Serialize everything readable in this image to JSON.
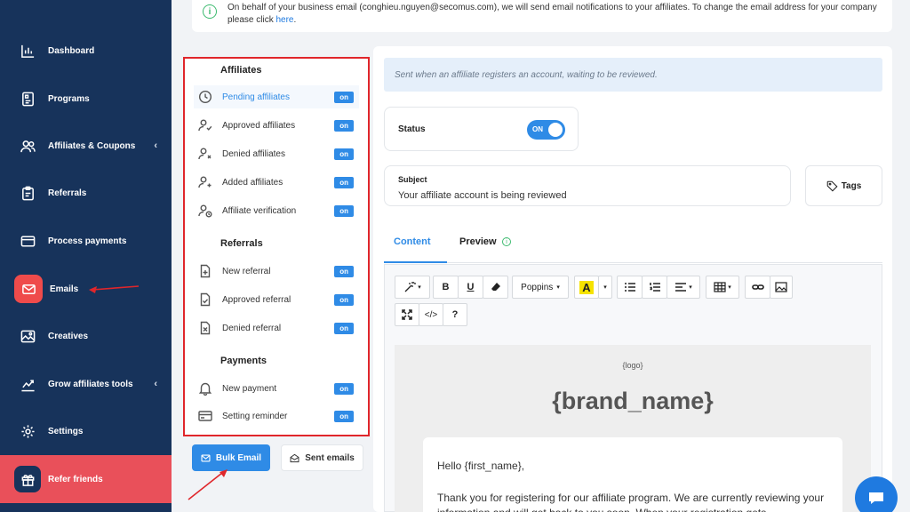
{
  "sidebar": {
    "items": [
      {
        "label": "Dashboard",
        "icon": "bar-chart-icon"
      },
      {
        "label": "Programs",
        "icon": "document-icon"
      },
      {
        "label": "Affiliates & Coupons",
        "icon": "users-icon",
        "has_chevron": true
      },
      {
        "label": "Referrals",
        "icon": "clipboard-icon"
      },
      {
        "label": "Process payments",
        "icon": "card-icon"
      },
      {
        "label": "Emails",
        "icon": "mail-icon",
        "active": true
      },
      {
        "label": "Creatives",
        "icon": "image-icon"
      },
      {
        "label": "Grow affiliates tools",
        "icon": "growth-icon",
        "has_chevron": true
      },
      {
        "label": "Settings",
        "icon": "gear-icon"
      }
    ],
    "refer": {
      "label": "Refer friends",
      "icon": "gift-icon"
    },
    "chevron": "‹"
  },
  "notice": {
    "text": "On behalf of your business email (conghieu.nguyen@secomus.com), we will send email notifications to your affiliates. To change the email address for your company please click ",
    "link": "here",
    "suffix": "."
  },
  "email_list": {
    "sections": [
      {
        "title": "Affiliates",
        "items": [
          {
            "label": "Pending affiliates",
            "icon": "clock-icon",
            "toggle": "on",
            "selected": true
          },
          {
            "label": "Approved affiliates",
            "icon": "user-check-icon",
            "toggle": "on"
          },
          {
            "label": "Denied affiliates",
            "icon": "user-x-icon",
            "toggle": "on"
          },
          {
            "label": "Added affiliates",
            "icon": "user-plus-icon",
            "toggle": "on"
          },
          {
            "label": "Affiliate verification",
            "icon": "user-clock-icon",
            "toggle": "on"
          }
        ]
      },
      {
        "title": "Referrals",
        "items": [
          {
            "label": "New referral",
            "icon": "file-plus-icon",
            "toggle": "on"
          },
          {
            "label": "Approved referral",
            "icon": "file-check-icon",
            "toggle": "on"
          },
          {
            "label": "Denied referral",
            "icon": "file-x-icon",
            "toggle": "on"
          }
        ]
      },
      {
        "title": "Payments",
        "items": [
          {
            "label": "New payment",
            "icon": "bell-icon",
            "toggle": "on"
          },
          {
            "label": "Setting reminder",
            "icon": "card-icon",
            "toggle": "on"
          }
        ]
      }
    ],
    "bulk_email": "Bulk Email",
    "sent_emails": "Sent emails"
  },
  "editor_panel": {
    "description": "Sent when an affiliate registers an account, waiting to be reviewed.",
    "status_label": "Status",
    "status_toggle": "ON",
    "subject_label": "Subject",
    "subject_value": "Your affiliate account is being reviewed",
    "tags_button": "Tags",
    "tabs": {
      "content": "Content",
      "preview": "Preview"
    },
    "toolbar": {
      "bold": "B",
      "underline": "U",
      "font": "Poppins",
      "code": "</>",
      "help": "?",
      "highlight": "A"
    },
    "email_preview": {
      "logo_placeholder": "{logo}",
      "brand_name": "{brand_name}",
      "greeting": "Hello {first_name},",
      "body": "Thank you for registering for our affiliate program. We are currently reviewing your information and will get back to you soon. When your registration gets"
    }
  },
  "colors": {
    "sidebar": "#17335b",
    "accent": "#2f8be6",
    "active_nav": "#ef4b4b",
    "highlight": "#e0262b"
  }
}
